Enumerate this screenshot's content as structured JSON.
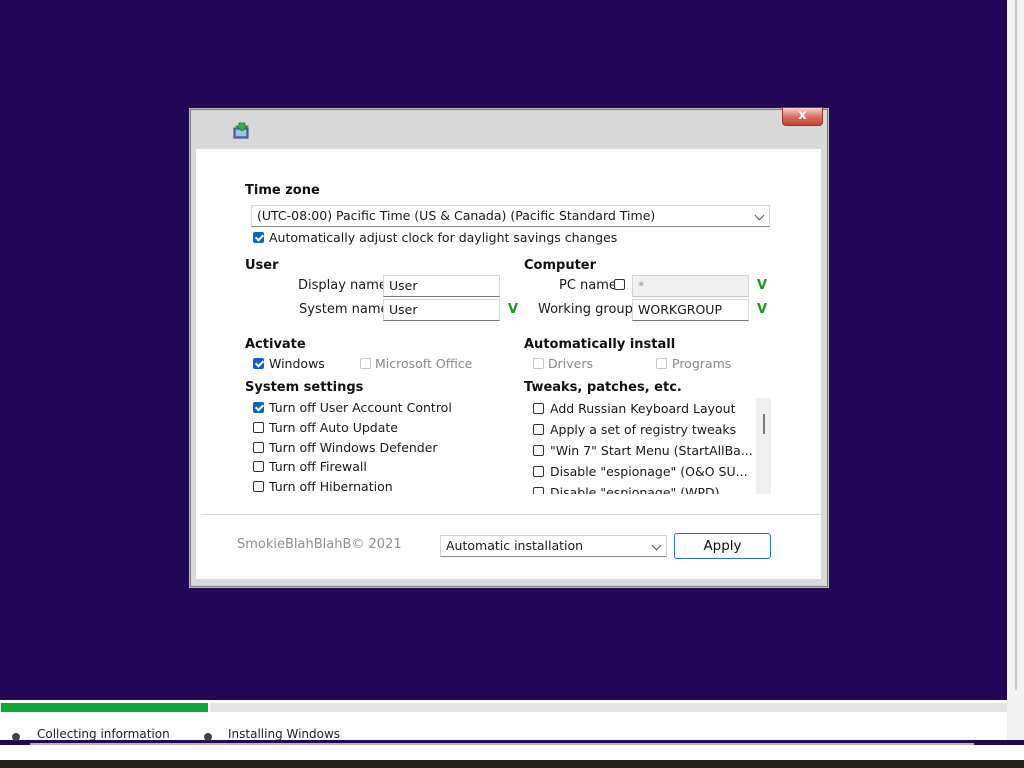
{
  "window": {
    "close_label": "x"
  },
  "timezone": {
    "title": "Time zone",
    "selected": "(UTC-08:00) Pacific Time (US & Canada) (Pacific Standard Time)",
    "daylight_label": "Automatically adjust clock for daylight savings changes",
    "daylight_checked": true
  },
  "user": {
    "title": "User",
    "display_name_label": "Display name",
    "display_name_value": "User",
    "system_name_label": "System name",
    "system_name_value": "User",
    "system_name_valid": "V"
  },
  "computer": {
    "title": "Computer",
    "pc_name_label": "PC name",
    "pc_name_value": "*",
    "pc_name_valid": "V",
    "workgroup_label": "Working group",
    "workgroup_value": "WORKGROUP",
    "workgroup_valid": "V"
  },
  "activate": {
    "title": "Activate",
    "windows_label": "Windows",
    "office_label": "Microsoft Office"
  },
  "auto_install": {
    "title": "Automatically install",
    "drivers_label": "Drivers",
    "programs_label": "Programs"
  },
  "system_settings": {
    "title": "System settings",
    "items": [
      {
        "label": "Turn off User Account Control",
        "checked": true
      },
      {
        "label": "Turn off Auto Update",
        "checked": false
      },
      {
        "label": "Turn off Windows Defender",
        "checked": false
      },
      {
        "label": "Turn off Firewall",
        "checked": false
      },
      {
        "label": "Turn off Hibernation",
        "checked": false
      }
    ]
  },
  "tweaks": {
    "title": "Tweaks, patches, etc.",
    "items": [
      {
        "label": "Add Russian Keyboard Layout",
        "checked": false
      },
      {
        "label": "Apply a set of registry tweaks",
        "checked": false
      },
      {
        "label": "\"Win 7\" Start Menu (StartAllBa...",
        "checked": false
      },
      {
        "label": "Disable \"espionage\" (O&O SU...",
        "checked": false
      },
      {
        "label": "Disable \"espionage\" (WPD)",
        "checked": false
      }
    ]
  },
  "footer": {
    "copyright": "SmokieBlahBlahB© 2021",
    "mode_selected": "Automatic installation",
    "apply_label": "Apply"
  },
  "setup_progress": {
    "progress": 0.207,
    "step1_label": "Collecting information",
    "step2_label": "Installing Windows"
  },
  "colors": {
    "background": "#200654",
    "progress": "#08a83a",
    "checkbox_checked": "#0b63c3",
    "valid_mark": "#19981f"
  }
}
